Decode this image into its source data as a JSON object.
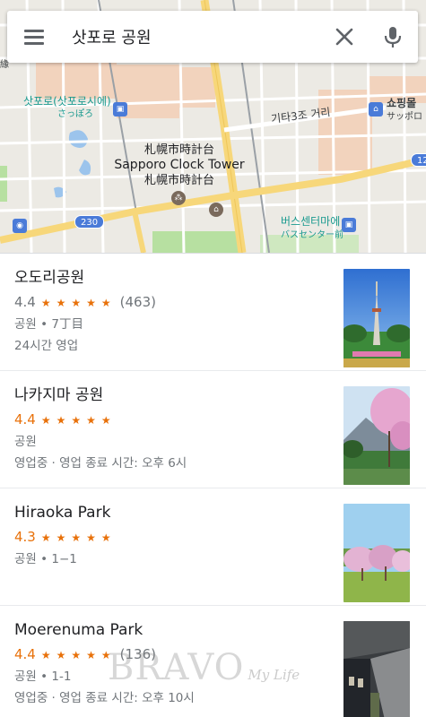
{
  "search": {
    "query": "삿포로 공원",
    "menu_icon": "hamburger-menu-icon",
    "clear_icon": "close-icon",
    "mic_icon": "microphone-icon"
  },
  "map": {
    "labels": {
      "sapporo_station_ko": "삿포로(삿포로시에)",
      "sapporo_station_jp": "さっぽろ",
      "street_ko": "기타3조 거리",
      "shopping_ko": "쇼핑몰",
      "shopping_jp": "サッポロ",
      "clock_jp": "札幌市時計台",
      "clock_en": "Sapporo Clock Tower",
      "clock_jp2": "札幌市時計台",
      "bus_center_ko": "버스센터마에",
      "bus_center_jp": "バスセンター前",
      "route_230": "230",
      "route_12": "12",
      "edge_fragment": "緣"
    },
    "colors": {
      "background": "#eceae4",
      "block": "#f2d3bd",
      "road_major": "#f7d77a",
      "road_minor": "#ffffff",
      "rail": "#9aa0a6",
      "water": "#9cc4ec",
      "park": "#b7e0a1",
      "teal_label": "#1a9a8f"
    }
  },
  "results": [
    {
      "name": "오도리공원",
      "rating": "4.4",
      "stars": "★★★★★",
      "count": "(463)",
      "line1": "공원 • 7丁目",
      "line2": "24시간 영업",
      "rating_style": "grey",
      "photo_icon": "tv-tower-park-photo"
    },
    {
      "name": "나카지마 공원",
      "rating": "4.4",
      "stars": "★★★★★",
      "count": "",
      "line1": "공원",
      "line2": "영업중 · 영업 종료 시간: 오후 6시",
      "rating_style": "orange",
      "photo_icon": "cherry-blossom-photo"
    },
    {
      "name": "Hiraoka Park",
      "rating": "4.3",
      "stars": "★★★★★",
      "count": "",
      "line1": "공원 • 1−1",
      "line2": "",
      "rating_style": "orange",
      "photo_icon": "plum-grove-photo"
    },
    {
      "name": "Moerenuma Park",
      "rating": "4.4",
      "stars": "★★★★★",
      "count": "(136)",
      "line1": "공원 • 1-1",
      "line2": "영업중 · 영업 종료 시간: 오후 10시",
      "rating_style": "orange",
      "photo_icon": "concrete-walkway-photo"
    }
  ],
  "watermark": {
    "main": "BRAVO",
    "sub": "My Life"
  }
}
